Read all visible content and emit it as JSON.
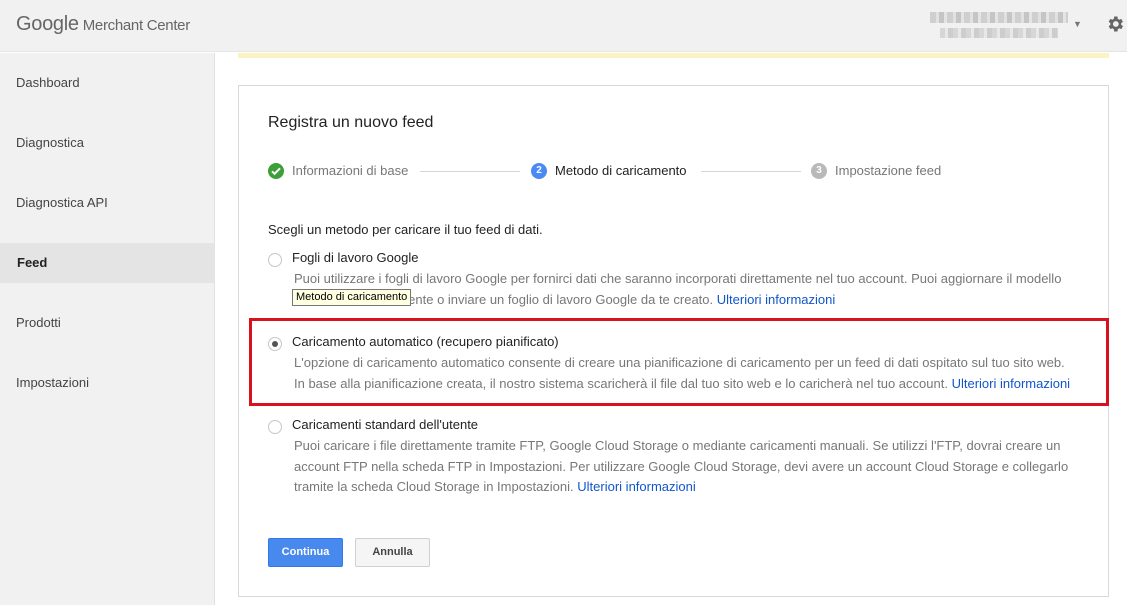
{
  "header": {
    "logo_google": "Google",
    "logo_product": "Merchant Center",
    "icons": {
      "settings": "gear-icon",
      "account_caret": "caret-down-icon"
    }
  },
  "sidebar": {
    "items": [
      {
        "label": "Dashboard",
        "active": false
      },
      {
        "label": "Diagnostica",
        "active": false
      },
      {
        "label": "Diagnostica API",
        "active": false
      },
      {
        "label": "Feed",
        "active": true
      },
      {
        "label": "Prodotti",
        "active": false
      },
      {
        "label": "Impostazioni",
        "active": false
      }
    ]
  },
  "card": {
    "title": "Registra un nuovo feed",
    "steps": [
      {
        "label": "Informazioni di base",
        "status": "done",
        "icon": "check-icon"
      },
      {
        "label": "Metodo di caricamento",
        "status": "current",
        "number": "2"
      },
      {
        "label": "Impostazione feed",
        "status": "pending",
        "number": "3"
      }
    ],
    "prompt": "Scegli un metodo per caricare il tuo feed di dati.",
    "options": [
      {
        "title": "Fogli di lavoro Google",
        "selected": false,
        "desc_line1": "Puoi utilizzare i fogli di lavoro Google per fornirci dati che saranno incorporati direttamente nel tuo account. Puoi aggiornare il modello",
        "desc_line2": "creato automaticamente o inviare un foglio di lavoro Google da te creato.",
        "link": "Ulteriori informazioni"
      },
      {
        "title": "Caricamento automatico (recupero pianificato)",
        "selected": true,
        "desc_line1": "L'opzione di caricamento automatico consente di creare una pianificazione di caricamento per un feed di dati ospitato sul tuo sito web.",
        "desc_line2": "In base alla pianificazione creata, il nostro sistema scaricherà il file dal tuo sito web e lo caricherà nel tuo account.",
        "link": "Ulteriori informazioni"
      },
      {
        "title": "Caricamenti standard dell'utente",
        "selected": false,
        "desc_line1": "Puoi caricare i file direttamente tramite FTP, Google Cloud Storage o mediante caricamenti manuali. Se utilizzi l'FTP, dovrai creare un",
        "desc_line2": "account FTP nella scheda FTP in Impostazioni. Per utilizzare Google Cloud Storage, devi avere un account Cloud Storage e collegarlo",
        "desc_line3": "tramite la scheda Cloud Storage in Impostazioni.",
        "link": "Ulteriori informazioni"
      }
    ],
    "tooltip": "Metodo di caricamento",
    "buttons": {
      "continue": "Continua",
      "cancel": "Annulla"
    }
  },
  "colors": {
    "primary_button": "#4889ed",
    "step_done": "#3d9f37",
    "step_current": "#4a8af4",
    "highlight_border": "#d9111e",
    "link": "#1155cc"
  }
}
